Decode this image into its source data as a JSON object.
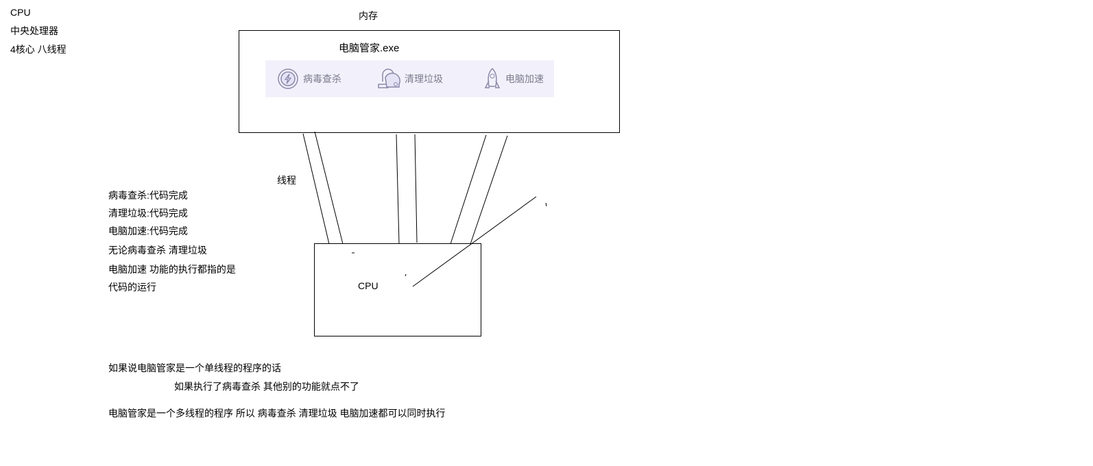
{
  "cpu_notes": [
    "CPU",
    "中央处理器",
    "4核心 八线程"
  ],
  "memory_label": "内存",
  "app": {
    "title": "电脑管家.exe",
    "features": [
      {
        "icon": "lightning-shield-icon",
        "label": "病毒查杀"
      },
      {
        "icon": "vacuum-cleaner-icon",
        "label": "清理垃圾"
      },
      {
        "icon": "rocket-icon",
        "label": "电脑加速"
      }
    ],
    "bar_color": "#f2f1fb"
  },
  "thread_label": "线程",
  "notes": [
    "病毒查杀:代码完成",
    "清理垃圾:代码完成",
    "电脑加速:代码完成",
    "无论病毒查杀 清理垃圾",
    "电脑加速 功能的执行都指的是",
    "代码的运行"
  ],
  "cpu_box_label": "CPU",
  "bottom": [
    "如果说电脑管家是一个单线程的程序的话",
    "如果执行了病毒查杀 其他别的功能就点不了",
    "电脑管家是一个多线程的程序 所以 病毒查杀 清理垃圾 电脑加速都可以同时执行"
  ]
}
